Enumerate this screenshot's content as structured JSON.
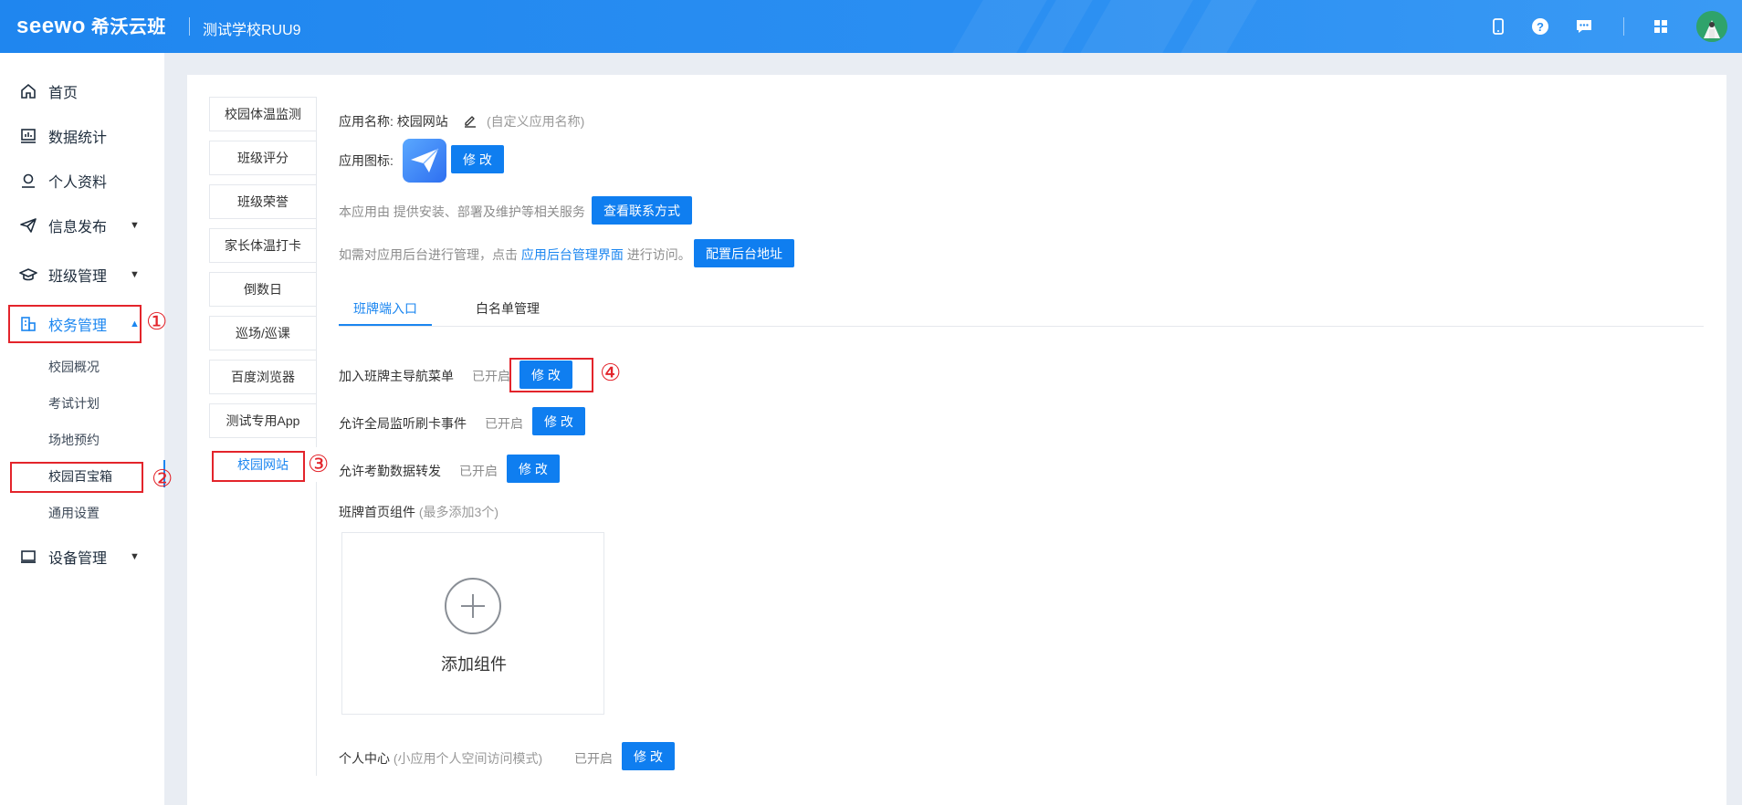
{
  "header": {
    "brand_en": "seewo",
    "brand_cn": "希沃云班",
    "school": "测试学校RUU9",
    "icons": [
      "phone-icon",
      "help-icon",
      "message-icon",
      "apps-grid-icon"
    ],
    "accent": "#1b86f0"
  },
  "sidebar": {
    "items": [
      {
        "label": "首页",
        "icon": "home-icon"
      },
      {
        "label": "数据统计",
        "icon": "chart-icon"
      },
      {
        "label": "个人资料",
        "icon": "user-icon"
      },
      {
        "label": "信息发布",
        "icon": "send-icon"
      },
      {
        "label": "班级管理",
        "icon": "graduation-cap-icon"
      },
      {
        "label": "校务管理",
        "icon": "building-icon"
      },
      {
        "label": "设备管理",
        "icon": "monitor-icon"
      }
    ],
    "sub_items": [
      "校园概况",
      "考试计划",
      "场地预约",
      "校园百宝箱",
      "通用设置"
    ]
  },
  "annotations": {
    "n1": "①",
    "n2": "②",
    "n3": "③",
    "n4": "④",
    "color": "#e3242b"
  },
  "app_tabs": [
    "校园体温监测",
    "班级评分",
    "班级荣誉",
    "家长体温打卡",
    "倒数日",
    "巡场/巡课",
    "百度浏览器",
    "测试专用App",
    "校园网站"
  ],
  "detail": {
    "name_label": "应用名称:",
    "name_value": "校园网站",
    "name_hint": "(自定义应用名称)",
    "icon_label": "应用图标:",
    "modify_btn": "修 改",
    "provider_text": "本应用由  提供安装、部署及维护等相关服务",
    "contact_btn": "查看联系方式",
    "admin_text_1": "如需对应用后台进行管理，点击",
    "admin_link": "应用后台管理界面",
    "admin_text_2": "进行访问。",
    "config_btn": "配置后台地址",
    "subtabs": [
      "班牌端入口",
      "白名单管理"
    ],
    "settings": [
      {
        "label": "加入班牌主导航菜单",
        "status": "已开启",
        "btn": "修 改"
      },
      {
        "label": "允许全局监听刷卡事件",
        "status": "已开启",
        "btn": "修 改"
      },
      {
        "label": "允许考勤数据转发",
        "status": "已开启",
        "btn": "修 改"
      }
    ],
    "components_label": "班牌首页组件",
    "components_hint": "(最多添加3个)",
    "add_component": "添加组件",
    "personal_label": "个人中心",
    "personal_hint": "(小应用个人空间访问模式)",
    "personal_status": "已开启",
    "personal_btn": "修 改"
  }
}
